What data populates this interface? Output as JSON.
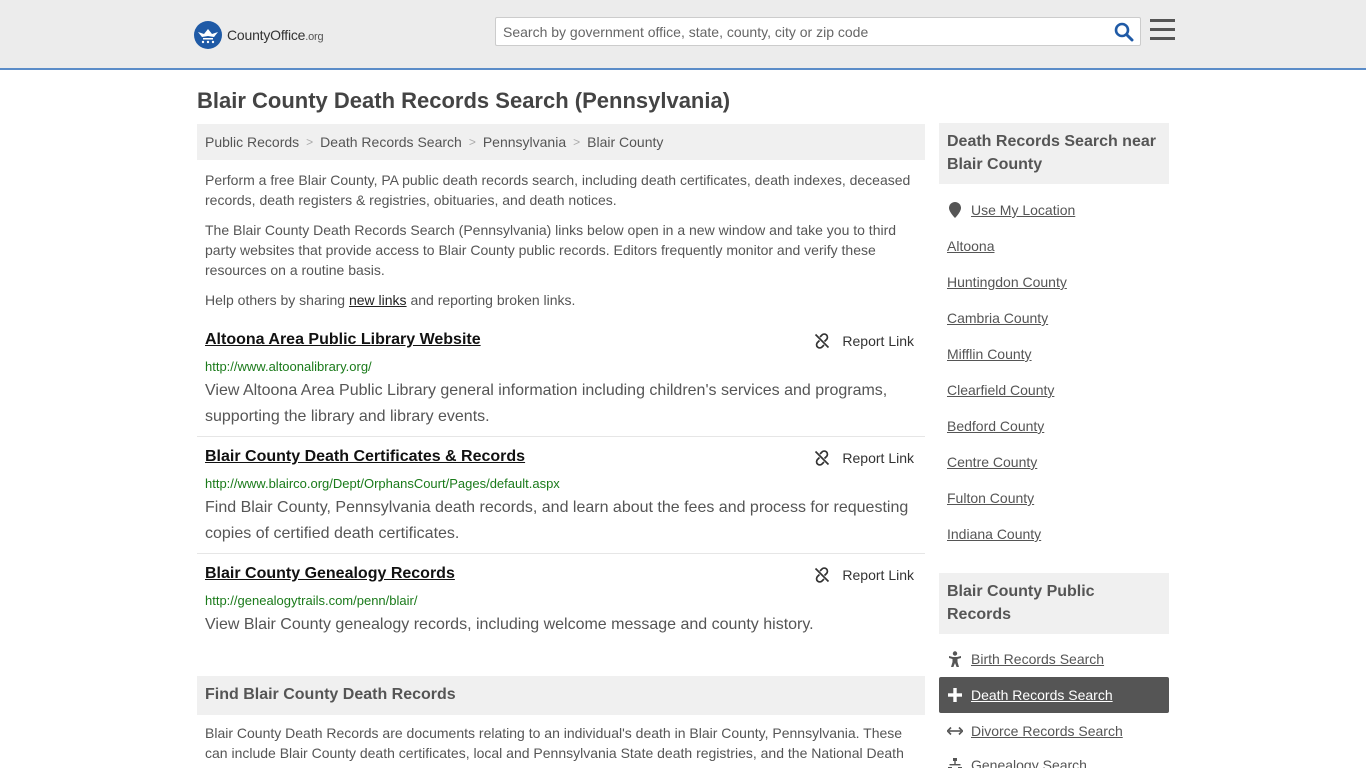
{
  "header": {
    "logo_main": "CountyOffice",
    "logo_tld": ".org",
    "search_placeholder": "Search by government office, state, county, city or zip code"
  },
  "page": {
    "title": "Blair County Death Records Search (Pennsylvania)"
  },
  "breadcrumb": [
    "Public Records",
    "Death Records Search",
    "Pennsylvania",
    "Blair County"
  ],
  "intro": {
    "p1": "Perform a free Blair County, PA public death records search, including death certificates, death indexes, deceased records, death registers & registries, obituaries, and death notices.",
    "p2": "The Blair County Death Records Search (Pennsylvania) links below open in a new window and take you to third party websites that provide access to Blair County public records. Editors frequently monitor and verify these resources on a routine basis.",
    "p3_before": "Help others by sharing ",
    "p3_link": "new links",
    "p3_after": " and reporting broken links."
  },
  "report_label": "Report Link",
  "results": [
    {
      "title": "Altoona Area Public Library Website",
      "url": "http://www.altoonalibrary.org/",
      "desc": "View Altoona Area Public Library general information including children's services and programs, supporting the library and library events."
    },
    {
      "title": "Blair County Death Certificates & Records",
      "url": "http://www.blairco.org/Dept/OrphansCourt/Pages/default.aspx",
      "desc": "Find Blair County, Pennsylvania death records, and learn about the fees and process for requesting copies of certified death certificates."
    },
    {
      "title": "Blair County Genealogy Records",
      "url": "http://genealogytrails.com/penn/blair/",
      "desc": "View Blair County genealogy records, including welcome message and county history."
    }
  ],
  "find_section": {
    "heading": "Find Blair County Death Records",
    "text": "Blair County Death Records are documents relating to an individual's death in Blair County, Pennsylvania. These can include Blair County death certificates, local and Pennsylvania State death registries, and the National Death"
  },
  "sidebar": {
    "nearby_heading": "Death Records Search near Blair County",
    "use_location": "Use My Location",
    "nearby": [
      "Altoona",
      "Huntingdon County",
      "Cambria County",
      "Mifflin County",
      "Clearfield County",
      "Bedford County",
      "Centre County",
      "Fulton County",
      "Indiana County"
    ],
    "public_heading": "Blair County Public Records",
    "public_links": [
      {
        "label": "Birth Records Search",
        "icon": "child-icon"
      },
      {
        "label": "Death Records Search",
        "icon": "cross-icon",
        "active": true
      },
      {
        "label": "Divorce Records Search",
        "icon": "arrows-horizontal-icon"
      },
      {
        "label": "Genealogy Search",
        "icon": "tree-icon"
      }
    ]
  },
  "colors": {
    "header_bg": "#ececec",
    "header_border": "#5b8cc8",
    "logo_blue": "#1f5aa6",
    "url_green": "#1a7a1a",
    "active_bg": "#555555"
  }
}
